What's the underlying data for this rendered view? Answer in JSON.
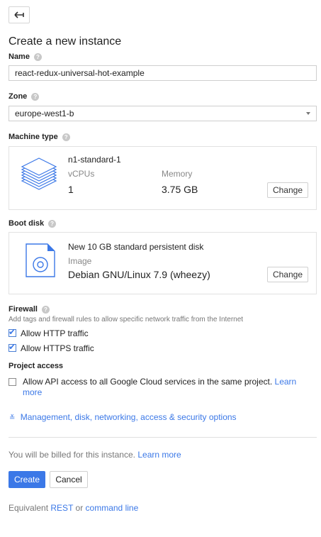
{
  "back_icon": "arrow-left-icon",
  "title": "Create a new instance",
  "name": {
    "label": "Name",
    "value": "react-redux-universal-hot-example"
  },
  "zone": {
    "label": "Zone",
    "value": "europe-west1-b"
  },
  "machine_type": {
    "label": "Machine type",
    "name": "n1-standard-1",
    "vcpus_label": "vCPUs",
    "vcpus_value": "1",
    "memory_label": "Memory",
    "memory_value": "3.75 GB",
    "change": "Change"
  },
  "boot_disk": {
    "label": "Boot disk",
    "description": "New 10 GB standard persistent disk",
    "image_label": "Image",
    "image_value": "Debian GNU/Linux 7.9 (wheezy)",
    "change": "Change"
  },
  "firewall": {
    "label": "Firewall",
    "description": "Add tags and firewall rules to allow specific network traffic from the Internet",
    "http_label": "Allow HTTP traffic",
    "http_checked": true,
    "https_label": "Allow HTTPS traffic",
    "https_checked": true
  },
  "project_access": {
    "label": "Project access",
    "api_text": "Allow API access to all Google Cloud services in the same project.",
    "learn": "Learn",
    "more": "more"
  },
  "management_link": "Management, disk, networking, access & security options",
  "billing": {
    "text": "You will be billed for this instance.",
    "link": "Learn more"
  },
  "buttons": {
    "create": "Create",
    "cancel": "Cancel"
  },
  "footer": {
    "prefix": "Equivalent",
    "rest": "REST",
    "or": "or",
    "command_line": "command line"
  },
  "colors": {
    "accent": "#3b78e7",
    "border": "#e2e2e2"
  }
}
